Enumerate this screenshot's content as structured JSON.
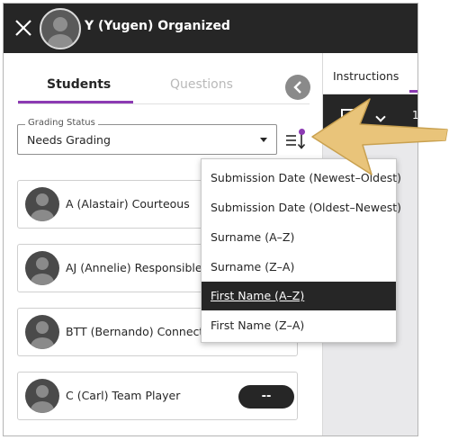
{
  "header": {
    "student_name": "Y (Yugen) Organized",
    "close_icon": "close-icon",
    "avatar_icon": "person-avatar"
  },
  "tabs": {
    "students_label": "Students",
    "questions_label": "Questions",
    "back_icon": "chevron-left-icon"
  },
  "filter": {
    "legend": "Grading Status",
    "value": "Needs Grading",
    "sort_icon": "sort-icon"
  },
  "students": [
    {
      "name": "A (Alastair) Courteous",
      "grade": ""
    },
    {
      "name": "AJ (Annelie) Responsible",
      "grade": ""
    },
    {
      "name": "BTT (Bernando) Connected",
      "grade": ""
    },
    {
      "name": "C (Carl) Team Player",
      "grade": "--"
    }
  ],
  "right_panel": {
    "tab_label": "Instructions",
    "toolbar_page_number": "1"
  },
  "sort_menu": {
    "items": [
      "Submission Date (Newest–Oldest)",
      "Submission Date (Oldest–Newest)",
      "Surname (A–Z)",
      "Surname (Z–A)",
      "First Name (A–Z)",
      "First Name (Z–A)"
    ],
    "selected_index": 4
  },
  "colors": {
    "accent": "#8c3ab3",
    "header_bg": "#262626",
    "callout_arrow": "#e9c47a"
  }
}
